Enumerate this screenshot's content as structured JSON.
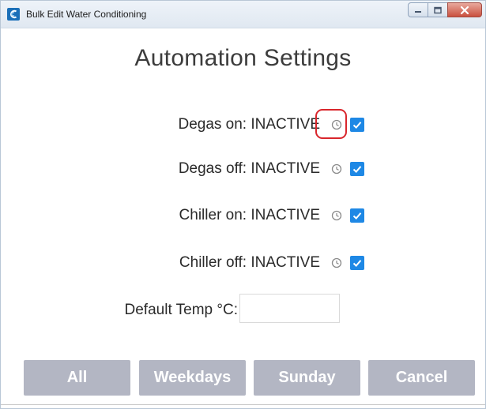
{
  "window": {
    "title": "Bulk Edit Water Conditioning",
    "icon": "app-logo-icon",
    "controls": [
      "minimize-icon",
      "maximize-icon",
      "close-icon"
    ]
  },
  "heading": "Automation Settings",
  "schedules": [
    {
      "label": "Degas on: INACTIVE",
      "icon": "clock-icon",
      "checked": true,
      "highlighted": true
    },
    {
      "label": "Degas off: INACTIVE",
      "icon": "clock-icon",
      "checked": true,
      "highlighted": false
    },
    {
      "label": "Chiller on: INACTIVE",
      "icon": "clock-icon",
      "checked": true,
      "highlighted": false
    },
    {
      "label": "Chiller off: INACTIVE",
      "icon": "clock-icon",
      "checked": true,
      "highlighted": false
    }
  ],
  "default_temp": {
    "label": "Default Temp °C:",
    "value": "",
    "placeholder": ""
  },
  "buttons": {
    "all": "All",
    "weekdays": "Weekdays",
    "sunday": "Sunday",
    "cancel": "Cancel"
  },
  "colors": {
    "checkbox": "#1e88e5",
    "button_bg": "#b3b6c3",
    "highlight": "#d9262c"
  }
}
